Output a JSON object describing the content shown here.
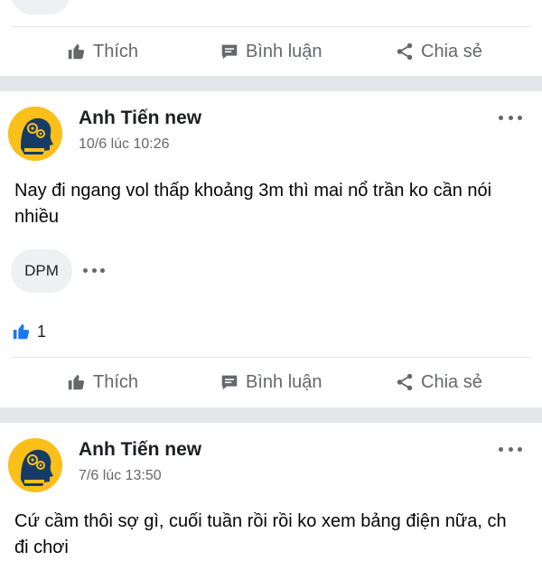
{
  "actions": {
    "like_label": "Thích",
    "comment_label": "Bình luận",
    "share_label": "Chia sẻ"
  },
  "posts": [
    {
      "author": "Anh Tiến new",
      "timestamp": "10/6 lúc 10:26",
      "text": "Nay đi ngang vol thấp khoảng 3m thì mai nổ trần ko cần nói nhiều",
      "tag": "DPM",
      "like_count": "1"
    },
    {
      "author": "Anh Tiến new",
      "timestamp": "7/6 lúc 13:50",
      "text": "Cứ cầm thôi sợ gì, cuối tuần rồi rồi ko xem bảng điện nữa, ch đi chơi"
    }
  ],
  "icons": {
    "like": "thumbs-up-icon",
    "comment": "comment-bubble-icon",
    "share": "share-nodes-icon",
    "more": "more-horizontal-icon",
    "reaction": "like-reaction-icon"
  },
  "colors": {
    "accent": "#1877f2",
    "muted_text": "#65676b",
    "separator": "#e4e6e9",
    "avatar_bg": "#fbbf1a"
  }
}
